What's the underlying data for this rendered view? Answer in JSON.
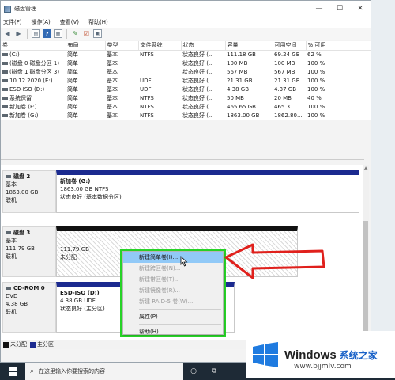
{
  "window": {
    "title": "磁盘管理",
    "min": "—",
    "max": "☐",
    "close": "✕"
  },
  "menu": [
    "文件(F)",
    "操作(A)",
    "查看(V)",
    "帮助(H)"
  ],
  "toolbar": {
    "help_label": "?"
  },
  "table": {
    "columns": [
      "卷",
      "布局",
      "类型",
      "文件系统",
      "状态",
      "容量",
      "可用空间",
      "% 可用"
    ],
    "rows": [
      [
        "(C:)",
        "简单",
        "基本",
        "NTFS",
        "状态良好 (...",
        "111.18 GB",
        "69.24 GB",
        "62 %"
      ],
      [
        "(磁盘 0 磁盘分区 1)",
        "简单",
        "基本",
        "",
        "状态良好 (...",
        "100 MB",
        "100 MB",
        "100 %"
      ],
      [
        "(磁盘 1 磁盘分区 3)",
        "简单",
        "基本",
        "",
        "状态良好 (...",
        "567 MB",
        "567 MB",
        "100 %"
      ],
      [
        "10 12 2020 (E:)",
        "简单",
        "基本",
        "UDF",
        "状态良好 (...",
        "21.31 GB",
        "21.31 GB",
        "100 %"
      ],
      [
        "ESD-ISO (D:)",
        "简单",
        "基本",
        "UDF",
        "状态良好 (...",
        "4.38 GB",
        "4.37 GB",
        "100 %"
      ],
      [
        "系统保留",
        "简单",
        "基本",
        "NTFS",
        "状态良好 (...",
        "50 MB",
        "20 MB",
        "40 %"
      ],
      [
        "新加卷 (F:)",
        "简单",
        "基本",
        "NTFS",
        "状态良好 (...",
        "465.65 GB",
        "465.31 ...",
        "100 %"
      ],
      [
        "新加卷 (G:)",
        "简单",
        "基本",
        "NTFS",
        "状态良好 (...",
        "1863.00 GB",
        "1862.80...",
        "100 %"
      ]
    ]
  },
  "disks": [
    {
      "name": "磁盘 2",
      "type": "基本",
      "size": "1863.00 GB",
      "status": "联机",
      "partition": {
        "name": "新加卷 (G:)",
        "line1": "1863.00 GB NTFS",
        "line2": "状态良好 (基本数据分区)"
      }
    },
    {
      "name": "磁盘 3",
      "type": "基本",
      "size": "111.79 GB",
      "status": "联机",
      "partition": {
        "name": "",
        "line1": "111.79 GB",
        "line2": "未分配"
      }
    },
    {
      "name": "CD-ROM 0",
      "type": "DVD",
      "size": "4.38 GB",
      "status": "联机",
      "partition": {
        "name": "ESD-ISO (D:)",
        "line1": "4.38 GB UDF",
        "line2": "状态良好 (主分区)"
      }
    }
  ],
  "context_menu": {
    "items": [
      {
        "label": "新建简单卷(I)...",
        "state": "highlighted"
      },
      {
        "label": "新建跨区卷(N)...",
        "state": "disabled"
      },
      {
        "label": "新建带区卷(T)...",
        "state": "disabled"
      },
      {
        "label": "新建镜像卷(R)...",
        "state": "disabled"
      },
      {
        "label": "新建 RAID-5 卷(W)...",
        "state": "disabled"
      },
      {
        "label": "属性(P)",
        "state": "enabled"
      },
      {
        "label": "帮助(H)",
        "state": "enabled"
      }
    ]
  },
  "legend": [
    {
      "label": "未分配",
      "color": "#111111"
    },
    {
      "label": "主分区",
      "color": "#1b2a8f"
    }
  ],
  "taskbar": {
    "search_placeholder": "在这里输入你要搜索的内容"
  },
  "watermark": {
    "brand": "Windows",
    "cn": "系统之家",
    "url": "www.bjjmlv.com"
  },
  "colors": {
    "highlight_box": "#27d327",
    "arrow": "#e0201c",
    "menu_hover": "#91c9f7",
    "partition_bar": "#1b2a8f"
  }
}
